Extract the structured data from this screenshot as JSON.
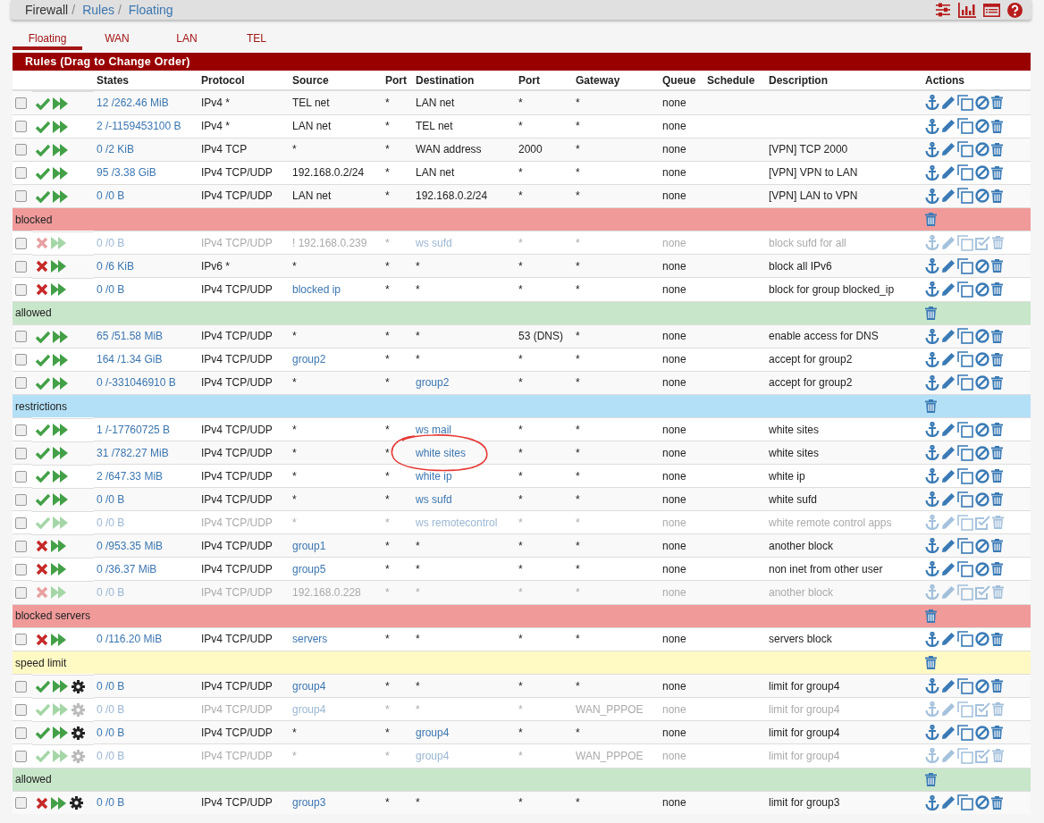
{
  "breadcrumb": [
    {
      "label": "Firewall",
      "separator": "/"
    },
    {
      "label": "Rules",
      "separator": "/"
    },
    {
      "label": "Floating"
    }
  ],
  "tabs": [
    {
      "label": "Floating",
      "selected": true
    },
    {
      "label": "WAN",
      "selected": false
    },
    {
      "label": "LAN",
      "selected": false
    },
    {
      "label": "TEL",
      "selected": false
    }
  ],
  "panel_title": "Rules (Drag to Change Order)",
  "columns": [
    "States",
    "Protocol",
    "Source",
    "Port",
    "Destination",
    "Port",
    "Gateway",
    "Queue",
    "Schedule",
    "Description",
    "Actions"
  ],
  "rows": [
    {
      "kind": "rule",
      "checked": false,
      "enabled": true,
      "blocked": false,
      "shaper": false,
      "circled": false,
      "states": "12 /262.46 MiB",
      "protocol": "IPv4 *",
      "source": "TEL net",
      "source_alias": false,
      "source_port": "*",
      "destination": "LAN net",
      "destination_alias": false,
      "destination_port": "*",
      "gateway": "*",
      "queue": "none"
    },
    {
      "kind": "rule",
      "checked": false,
      "enabled": true,
      "blocked": false,
      "shaper": false,
      "circled": false,
      "states": "2 /-1159453100 B",
      "protocol": "IPv4 *",
      "source": "LAN net",
      "source_alias": false,
      "source_port": "*",
      "destination": "TEL net",
      "destination_alias": false,
      "destination_port": "*",
      "gateway": "*",
      "queue": "none"
    },
    {
      "kind": "rule",
      "checked": false,
      "enabled": true,
      "blocked": false,
      "shaper": false,
      "circled": false,
      "states": "0 /2 KiB",
      "protocol": "IPv4 TCP",
      "source": "*",
      "source_alias": false,
      "source_port": "*",
      "destination": "WAN address",
      "destination_alias": false,
      "destination_port": "2000",
      "gateway": "*",
      "queue": "none",
      "description": "[VPN] TCP 2000"
    },
    {
      "kind": "rule",
      "checked": false,
      "enabled": true,
      "blocked": false,
      "shaper": false,
      "circled": false,
      "states": "95 /3.38 GiB",
      "protocol": "IPv4 TCP/UDP",
      "source": "192.168.0.2/24",
      "source_alias": false,
      "source_port": "*",
      "destination": "LAN net",
      "destination_alias": false,
      "destination_port": "*",
      "gateway": "*",
      "queue": "none",
      "description": "[VPN] VPN to LAN"
    },
    {
      "kind": "rule",
      "checked": false,
      "enabled": true,
      "blocked": false,
      "shaper": false,
      "circled": false,
      "states": "0 /0 B",
      "protocol": "IPv4 TCP/UDP",
      "source": "LAN net",
      "source_alias": false,
      "source_port": "*",
      "destination": "192.168.0.2/24",
      "destination_alias": false,
      "destination_port": "*",
      "gateway": "*",
      "queue": "none",
      "description": "[VPN] LAN to VPN"
    },
    {
      "kind": "separator",
      "label": "blocked",
      "color": "#f09a9a"
    },
    {
      "kind": "rule",
      "checked": false,
      "enabled": false,
      "blocked": true,
      "shaper": false,
      "circled": false,
      "states": "0 /0 B",
      "protocol": "IPv4 TCP/UDP",
      "source": "! 192.168.0.239",
      "source_alias": false,
      "source_port": "*",
      "destination": "ws sufd",
      "destination_alias": true,
      "destination_port": "*",
      "gateway": "*",
      "queue": "none",
      "description": "block sufd for all"
    },
    {
      "kind": "rule",
      "checked": false,
      "enabled": true,
      "blocked": true,
      "shaper": false,
      "circled": false,
      "states": "0 /6 KiB",
      "protocol": "IPv6 *",
      "source": "*",
      "source_alias": false,
      "source_port": "*",
      "destination": "*",
      "destination_alias": false,
      "destination_port": "*",
      "gateway": "*",
      "queue": "none",
      "description": "block all IPv6"
    },
    {
      "kind": "rule",
      "checked": false,
      "enabled": true,
      "blocked": true,
      "shaper": false,
      "circled": false,
      "states": "0 /0 B",
      "protocol": "IPv4 TCP/UDP",
      "source": "blocked ip",
      "source_alias": true,
      "source_port": "*",
      "destination": "*",
      "destination_alias": false,
      "destination_port": "*",
      "gateway": "*",
      "queue": "none",
      "description": "block for group blocked_ip"
    },
    {
      "kind": "separator",
      "label": "allowed",
      "color": "#c8e6c9"
    },
    {
      "kind": "rule",
      "checked": false,
      "enabled": true,
      "blocked": false,
      "shaper": false,
      "circled": false,
      "states": "65 /51.58 MiB",
      "protocol": "IPv4 TCP/UDP",
      "source": "*",
      "source_alias": false,
      "source_port": "*",
      "destination": "*",
      "destination_alias": false,
      "destination_port": "53 (DNS)",
      "gateway": "*",
      "queue": "none",
      "description": "enable access for DNS"
    },
    {
      "kind": "rule",
      "checked": false,
      "enabled": true,
      "blocked": false,
      "shaper": false,
      "circled": false,
      "states": "164 /1.34 GiB",
      "protocol": "IPv4 TCP/UDP",
      "source": "group2",
      "source_alias": true,
      "source_port": "*",
      "destination": "*",
      "destination_alias": false,
      "destination_port": "*",
      "gateway": "*",
      "queue": "none",
      "description": "accept for group2"
    },
    {
      "kind": "rule",
      "checked": false,
      "enabled": true,
      "blocked": false,
      "shaper": false,
      "circled": false,
      "states": "0 /-331046910 B",
      "protocol": "IPv4 TCP/UDP",
      "source": "*",
      "source_alias": false,
      "source_port": "*",
      "destination": "group2",
      "destination_alias": true,
      "destination_port": "*",
      "gateway": "*",
      "queue": "none",
      "description": "accept for group2"
    },
    {
      "kind": "separator",
      "label": "restrictions",
      "color": "#b3e0f7"
    },
    {
      "kind": "rule",
      "checked": false,
      "enabled": true,
      "blocked": false,
      "shaper": false,
      "circled": false,
      "states": "1 /-17760725 B",
      "protocol": "IPv4 TCP/UDP",
      "source": "*",
      "source_alias": false,
      "source_port": "*",
      "destination": "ws mail",
      "destination_alias": true,
      "destination_port": "*",
      "gateway": "*",
      "queue": "none",
      "description": "white sites"
    },
    {
      "kind": "rule",
      "checked": false,
      "enabled": true,
      "blocked": false,
      "shaper": false,
      "circled": true,
      "states": "31 /782.27 MiB",
      "protocol": "IPv4 TCP/UDP",
      "source": "*",
      "source_alias": false,
      "source_port": "*",
      "destination": "white sites",
      "destination_alias": true,
      "destination_port": "*",
      "gateway": "*",
      "queue": "none",
      "description": "white sites"
    },
    {
      "kind": "rule",
      "checked": false,
      "enabled": true,
      "blocked": false,
      "shaper": false,
      "circled": false,
      "states": "2 /647.33 MiB",
      "protocol": "IPv4 TCP/UDP",
      "source": "*",
      "source_alias": false,
      "source_port": "*",
      "destination": "white ip",
      "destination_alias": true,
      "destination_port": "*",
      "gateway": "*",
      "queue": "none",
      "description": "white ip"
    },
    {
      "kind": "rule",
      "checked": false,
      "enabled": true,
      "blocked": false,
      "shaper": false,
      "circled": false,
      "states": "0 /0 B",
      "protocol": "IPv4 TCP/UDP",
      "source": "*",
      "source_alias": false,
      "source_port": "*",
      "destination": "ws sufd",
      "destination_alias": true,
      "destination_port": "*",
      "gateway": "*",
      "queue": "none",
      "description": "white sufd"
    },
    {
      "kind": "rule",
      "checked": false,
      "enabled": false,
      "blocked": false,
      "shaper": false,
      "circled": false,
      "states": "0 /0 B",
      "protocol": "IPv4 TCP/UDP",
      "source": "*",
      "source_alias": false,
      "source_port": "*",
      "destination": "ws remotecontrol",
      "destination_alias": true,
      "destination_port": "*",
      "gateway": "*",
      "queue": "none",
      "description": "white remote control apps"
    },
    {
      "kind": "rule",
      "checked": false,
      "enabled": true,
      "blocked": true,
      "shaper": false,
      "circled": false,
      "states": "0 /953.35 MiB",
      "protocol": "IPv4 TCP/UDP",
      "source": "group1",
      "source_alias": true,
      "source_port": "*",
      "destination": "*",
      "destination_alias": false,
      "destination_port": "*",
      "gateway": "*",
      "queue": "none",
      "description": "another block"
    },
    {
      "kind": "rule",
      "checked": false,
      "enabled": true,
      "blocked": true,
      "shaper": false,
      "circled": false,
      "states": "0 /36.37 MiB",
      "protocol": "IPv4 TCP/UDP",
      "source": "group5",
      "source_alias": true,
      "source_port": "*",
      "destination": "*",
      "destination_alias": false,
      "destination_port": "*",
      "gateway": "*",
      "queue": "none",
      "description": "non inet from other user"
    },
    {
      "kind": "rule",
      "checked": false,
      "enabled": false,
      "blocked": true,
      "shaper": false,
      "circled": false,
      "states": "0 /0 B",
      "protocol": "IPv4 TCP/UDP",
      "source": "192.168.0.228",
      "source_alias": false,
      "source_port": "*",
      "destination": "*",
      "destination_alias": false,
      "destination_port": "*",
      "gateway": "*",
      "queue": "none",
      "description": "another block"
    },
    {
      "kind": "separator",
      "label": "blocked servers",
      "color": "#f09a9a"
    },
    {
      "kind": "rule",
      "checked": false,
      "enabled": true,
      "blocked": true,
      "shaper": false,
      "circled": false,
      "states": "0 /116.20 MiB",
      "protocol": "IPv4 TCP/UDP",
      "source": "servers",
      "source_alias": true,
      "source_port": "*",
      "destination": "*",
      "destination_alias": false,
      "destination_port": "*",
      "gateway": "*",
      "queue": "none",
      "description": "servers block"
    },
    {
      "kind": "separator",
      "label": "speed limit",
      "color": "#fff9c4"
    },
    {
      "kind": "rule",
      "checked": false,
      "enabled": true,
      "blocked": false,
      "shaper": true,
      "circled": false,
      "states": "0 /0 B",
      "protocol": "IPv4 TCP/UDP",
      "source": "group4",
      "source_alias": true,
      "source_port": "*",
      "destination": "*",
      "destination_alias": false,
      "destination_port": "*",
      "gateway": "*",
      "queue": "none",
      "description": "limit for group4"
    },
    {
      "kind": "rule",
      "checked": false,
      "enabled": false,
      "blocked": false,
      "shaper": true,
      "circled": false,
      "states": "0 /0 B",
      "protocol": "IPv4 TCP/UDP",
      "source": "group4",
      "source_alias": true,
      "source_port": "*",
      "destination": "*",
      "destination_alias": false,
      "destination_port": "*",
      "gateway": "WAN_PPPOE",
      "queue": "none",
      "description": "limit for group4"
    },
    {
      "kind": "rule",
      "checked": false,
      "enabled": true,
      "blocked": false,
      "shaper": true,
      "circled": false,
      "states": "0 /0 B",
      "protocol": "IPv4 TCP/UDP",
      "source": "*",
      "source_alias": false,
      "source_port": "*",
      "destination": "group4",
      "destination_alias": true,
      "destination_port": "*",
      "gateway": "*",
      "queue": "none",
      "description": "limit for group4"
    },
    {
      "kind": "rule",
      "checked": false,
      "enabled": false,
      "blocked": false,
      "shaper": true,
      "circled": false,
      "states": "0 /0 B",
      "protocol": "IPv4 TCP/UDP",
      "source": "*",
      "source_alias": false,
      "source_port": "*",
      "destination": "group4",
      "destination_alias": true,
      "destination_port": "*",
      "gateway": "WAN_PPPOE",
      "queue": "none",
      "description": "limit for group4"
    },
    {
      "kind": "separator",
      "label": "allowed",
      "color": "#c8e6c9"
    },
    {
      "kind": "rule",
      "checked": false,
      "enabled": true,
      "blocked": true,
      "shaper": true,
      "circled": false,
      "states": "0 /0 B",
      "protocol": "IPv4 TCP/UDP",
      "source": "group3",
      "source_alias": true,
      "source_port": "*",
      "destination": "*",
      "destination_alias": false,
      "destination_port": "*",
      "gateway": "*",
      "queue": "none",
      "description": "limit for group3"
    }
  ]
}
